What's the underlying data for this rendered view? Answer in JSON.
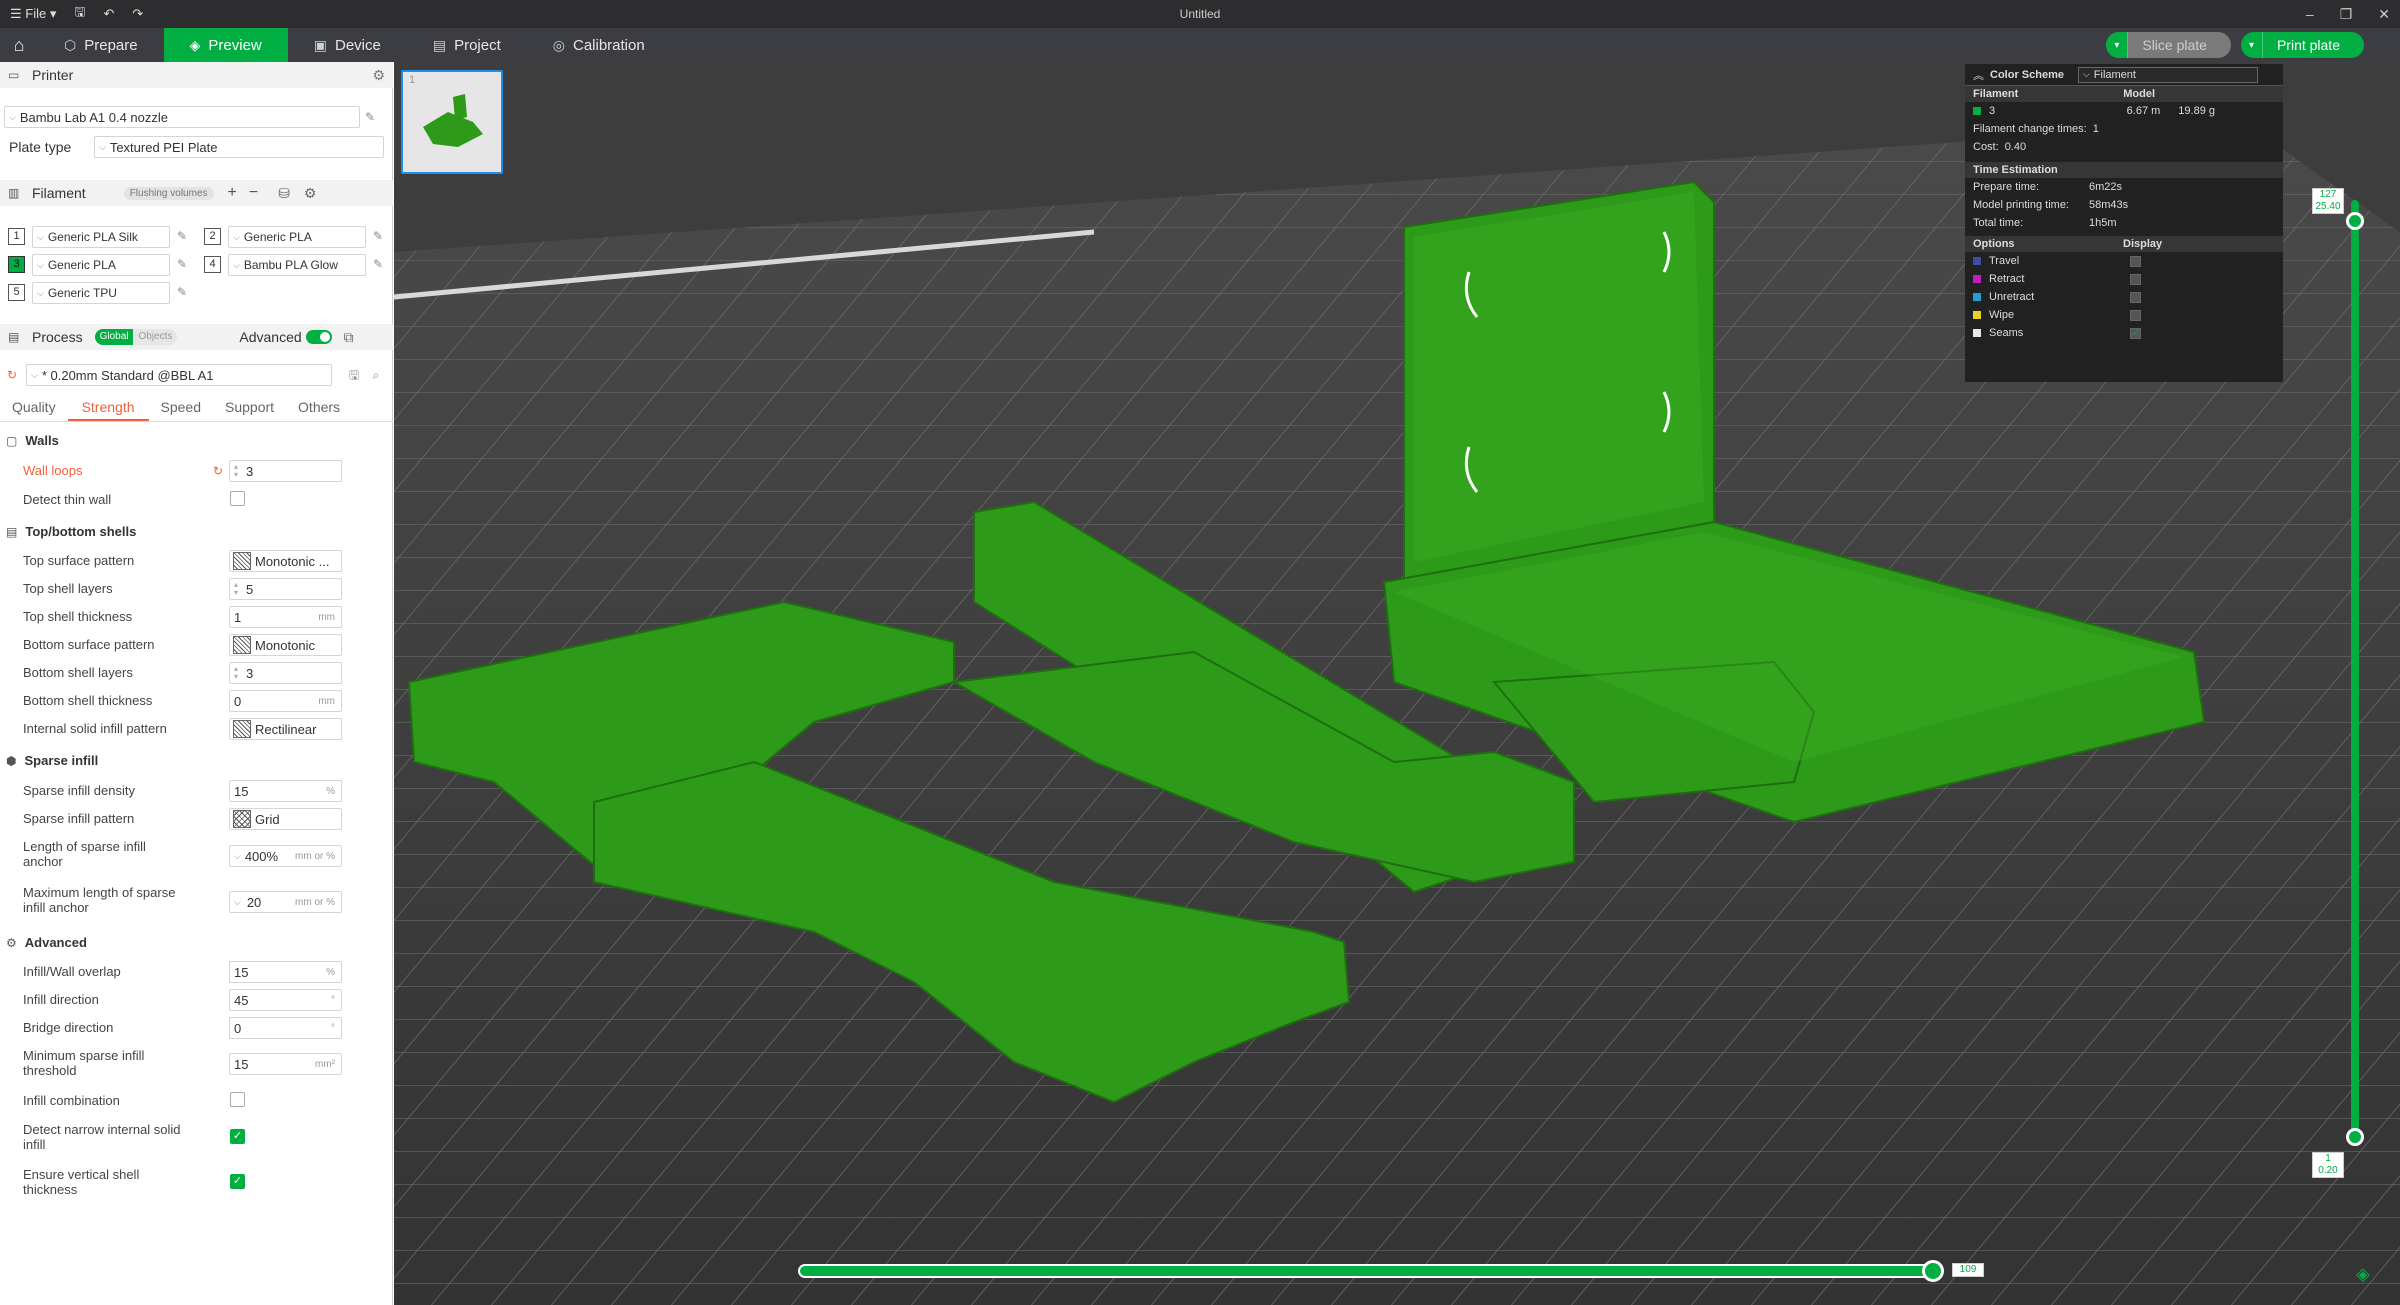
{
  "titlebar": {
    "file_label": "File",
    "title": "Untitled",
    "minimize": "–",
    "restore": "❐",
    "close": "✕"
  },
  "menubar": {
    "tabs": [
      {
        "label": "Prepare",
        "icon": "cube-icon"
      },
      {
        "label": "Preview",
        "icon": "layers-icon"
      },
      {
        "label": "Device",
        "icon": "device-icon"
      },
      {
        "label": "Project",
        "icon": "project-icon"
      },
      {
        "label": "Calibration",
        "icon": "calibration-icon"
      }
    ],
    "slice_label": "Slice plate",
    "print_label": "Print plate"
  },
  "printer": {
    "section_label": "Printer",
    "name": "Bambu Lab A1 0.4 nozzle",
    "plate_type_label": "Plate type",
    "plate_type": "Textured PEI Plate"
  },
  "filament": {
    "section_label": "Filament",
    "flushing_label": "Flushing volumes",
    "items": [
      {
        "num": "1",
        "name": "Generic PLA Silk",
        "color": "#ffffff"
      },
      {
        "num": "2",
        "name": "Generic PLA",
        "color": "#ffffff"
      },
      {
        "num": "3",
        "name": "Generic PLA",
        "color": "#00ae42"
      },
      {
        "num": "4",
        "name": "Bambu PLA Glow",
        "color": "#ffffff"
      },
      {
        "num": "5",
        "name": "Generic TPU",
        "color": "#ffffff"
      }
    ]
  },
  "process": {
    "section_label": "Process",
    "global_label": "Global",
    "objects_label": "Objects",
    "advanced_label": "Advanced",
    "preset": "* 0.20mm Standard @BBL A1",
    "tabs": [
      "Quality",
      "Strength",
      "Speed",
      "Support",
      "Others"
    ]
  },
  "walls": {
    "title": "Walls",
    "wall_loops_label": "Wall loops",
    "wall_loops": "3",
    "detect_thin_label": "Detect thin wall"
  },
  "shells": {
    "title": "Top/bottom shells",
    "top_pattern_label": "Top surface pattern",
    "top_pattern": "Monotonic ...",
    "top_layers_label": "Top shell layers",
    "top_layers": "5",
    "top_thickness_label": "Top shell thickness",
    "top_thickness": "1",
    "bottom_pattern_label": "Bottom surface pattern",
    "bottom_pattern": "Monotonic",
    "bottom_layers_label": "Bottom shell layers",
    "bottom_layers": "3",
    "bottom_thickness_label": "Bottom shell thickness",
    "bottom_thickness": "0",
    "internal_pattern_label": "Internal solid infill pattern",
    "internal_pattern": "Rectilinear",
    "unit_mm": "mm"
  },
  "sparse": {
    "title": "Sparse infill",
    "density_label": "Sparse infill density",
    "density": "15",
    "pattern_label": "Sparse infill pattern",
    "pattern": "Grid",
    "anchor_label_1": "Length of sparse infill",
    "anchor_label_2": "anchor",
    "anchor": "400%",
    "max_anchor_label_1": "Maximum length of sparse",
    "max_anchor_label_2": "infill anchor",
    "max_anchor": "20",
    "unit_percent": "%",
    "unit_mm_or_pct": "mm or %"
  },
  "advanced": {
    "title": "Advanced",
    "overlap_label": "Infill/Wall overlap",
    "overlap": "15",
    "infill_dir_label": "Infill direction",
    "infill_dir": "45",
    "bridge_dir_label": "Bridge direction",
    "bridge_dir": "0",
    "min_sparse_label_1": "Minimum sparse infill",
    "min_sparse_label_2": "threshold",
    "min_sparse": "15",
    "combination_label": "Infill combination",
    "narrow_label_1": "Detect narrow internal solid",
    "narrow_label_2": "infill",
    "vertical_label_1": "Ensure vertical shell",
    "vertical_label_2": "thickness",
    "unit_deg": "°",
    "unit_mm2": "mm²"
  },
  "stats": {
    "color_scheme_label": "Color Scheme",
    "color_scheme": "Filament",
    "col_filament": "Filament",
    "col_model": "Model",
    "filament_id": "3",
    "length": "6.67 m",
    "weight": "19.89 g",
    "change_times_label": "Filament change times:",
    "change_times": "1",
    "cost_label": "Cost:",
    "cost": "0.40",
    "time_title": "Time Estimation",
    "prepare_label": "Prepare time:",
    "prepare": "6m22s",
    "model_time_label": "Model printing time:",
    "model_time": "58m43s",
    "total_label": "Total time:",
    "total": "1h5m",
    "options_label": "Options",
    "display_label": "Display",
    "options": [
      {
        "name": "Travel",
        "color": "#3b4ea8"
      },
      {
        "name": "Retract",
        "color": "#c020c0"
      },
      {
        "name": "Unretract",
        "color": "#20a0d0"
      },
      {
        "name": "Wipe",
        "color": "#e6d020"
      },
      {
        "name": "Seams",
        "color": "#e6e6e6"
      }
    ]
  },
  "layers": {
    "top_layer": "127",
    "top_height": "25.40",
    "bottom_layer": "1",
    "bottom_height": "0.20",
    "move": "109"
  },
  "colors": {
    "accent": "#00ae42",
    "model": "#2d9a1a"
  }
}
